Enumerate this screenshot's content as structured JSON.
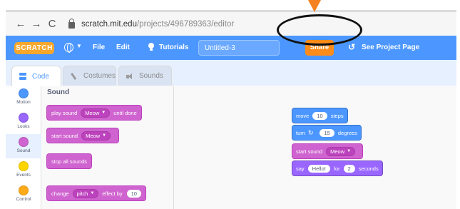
{
  "browser": {
    "back_glyph": "←",
    "forward_glyph": "→",
    "reload_glyph": "C",
    "url_host": "scratch.mit.edu",
    "url_path": "/projects/496789363/editor"
  },
  "menubar": {
    "logo_text": "SCRATCH",
    "file_label": "File",
    "edit_label": "Edit",
    "tutorials_label": "Tutorials",
    "project_title": "Untitled-3",
    "share_label": "Share",
    "see_project_icon": "remix-icon",
    "see_project_label": "See Project Page"
  },
  "tabs": [
    {
      "label": "Code",
      "icon": "code-icon",
      "active": true
    },
    {
      "label": "Costumes",
      "icon": "brush-icon",
      "active": false
    },
    {
      "label": "Sounds",
      "icon": "speaker-icon",
      "active": false
    }
  ],
  "categories": [
    {
      "label": "Motion",
      "color": "#4c97ff"
    },
    {
      "label": "Looks",
      "color": "#9966ff"
    },
    {
      "label": "Sound",
      "color": "#cf63cf",
      "selected": true
    },
    {
      "label": "Events",
      "color": "#ffd500"
    },
    {
      "label": "Control",
      "color": "#ffab19"
    }
  ],
  "palette": {
    "heading": "Sound",
    "blocks": {
      "play_until_done": {
        "pre": "play sound",
        "dd": "Meow",
        "post": "until done"
      },
      "start_sound": {
        "pre": "start sound",
        "dd": "Meow"
      },
      "stop_all": {
        "pre": "stop all sounds"
      },
      "change_effect": {
        "pre": "change",
        "dd": "pitch",
        "post": "effect by",
        "value": "10"
      }
    }
  },
  "script": {
    "move": {
      "pre": "move",
      "value": "10",
      "post": "steps"
    },
    "turn": {
      "pre": "turn",
      "arrow": "↻",
      "value": "15",
      "post": "degrees"
    },
    "start_sound": {
      "pre": "start sound",
      "dd": "Meow"
    },
    "say": {
      "pre": "say",
      "text": "Hello!",
      "mid": "for",
      "value": "2",
      "post": "seconds"
    }
  },
  "colors": {
    "menubar": "#4c97ff",
    "share_button": "#ff8c1a",
    "annotation_arrow": "#f58220",
    "annotation_circle": "#111111"
  }
}
